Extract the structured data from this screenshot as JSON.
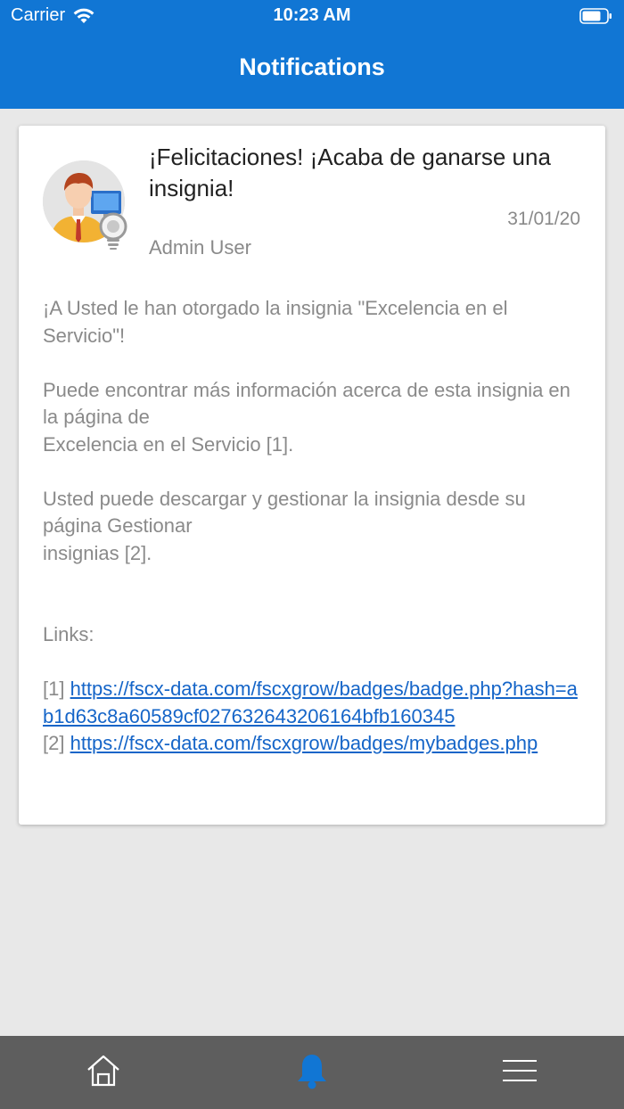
{
  "status_bar": {
    "carrier": "Carrier",
    "time": "10:23 AM"
  },
  "header": {
    "title": "Notifications",
    "background_color": "#1176d4"
  },
  "notification": {
    "title": "¡Felicitaciones! ¡Acaba de ganarse una insignia!",
    "date": "31/01/20",
    "sender": "Admin User",
    "body": {
      "paragraph1": "¡A Usted le han otorgado la insignia \"Excelencia en el Servicio\"!",
      "paragraph2_line1": "Puede encontrar más información acerca de esta insignia en la página de",
      "paragraph2_line2": "Excelencia en el Servicio [1].",
      "paragraph3_line1": "Usted puede descargar y gestionar la insignia desde su página Gestionar",
      "paragraph3_line2": "insignias [2].",
      "links_label": "Links:",
      "link1_prefix": "[1]",
      "link1_url": "https://fscx-data.com/fscxgrow/badges/badge.php?hash=ab1d63c8a60589cf027632643206164bfb160345",
      "link2_prefix": "[2]",
      "link2_url": "https://fscx-data.com/fscxgrow/badges/mybadges.php"
    },
    "link_color": "#1565c8"
  },
  "tab_bar": {
    "tabs": [
      {
        "icon": "home-icon",
        "active": false
      },
      {
        "icon": "bell-icon",
        "active": true
      },
      {
        "icon": "menu-icon",
        "active": false
      }
    ],
    "active_color": "#1176d4"
  }
}
